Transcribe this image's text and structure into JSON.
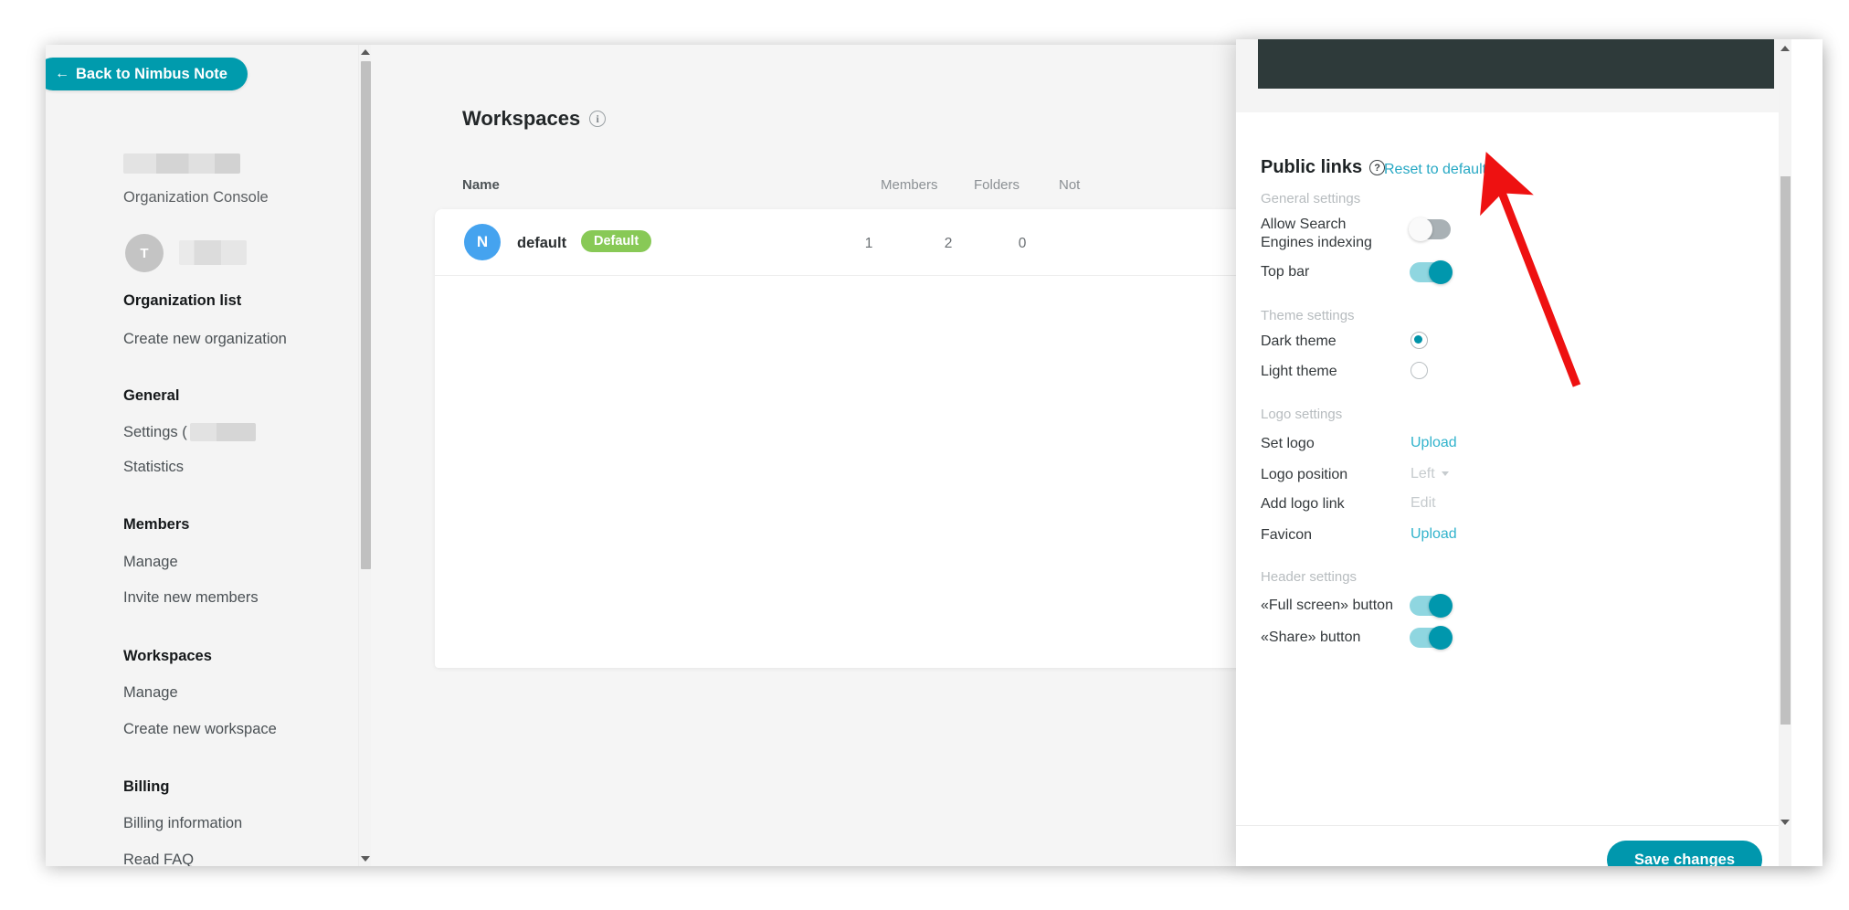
{
  "sidebar": {
    "back_button": {
      "label": "Back to Nimbus Note",
      "icon": "arrow-left-icon"
    },
    "org_console_label": "Organization Console",
    "user_avatar_initial": "T",
    "groups": [
      {
        "title": "Organization list",
        "items": [
          {
            "label": "Create new organization"
          }
        ]
      },
      {
        "title": "General",
        "items": [
          {
            "label": "Settings (",
            "masked": true
          },
          {
            "label": "Statistics"
          }
        ]
      },
      {
        "title": "Members",
        "items": [
          {
            "label": "Manage"
          },
          {
            "label": "Invite new members"
          }
        ]
      },
      {
        "title": "Workspaces",
        "items": [
          {
            "label": "Manage"
          },
          {
            "label": "Create new workspace"
          }
        ]
      },
      {
        "title": "Billing",
        "items": [
          {
            "label": "Billing information"
          },
          {
            "label": "Read FAQ"
          }
        ]
      }
    ]
  },
  "main": {
    "page_title": "Workspaces",
    "page_title_info_icon": "info-icon",
    "table": {
      "columns": [
        "Name",
        "Members",
        "Folders",
        "Not"
      ],
      "rows": [
        {
          "avatar_initial": "N",
          "name": "default",
          "tag": "Default",
          "members": "1",
          "folders": "2",
          "notes": "0"
        }
      ]
    }
  },
  "panel": {
    "title": "Public links",
    "title_help_icon": "question-circle-icon",
    "reset_link": "Reset to default",
    "sections": [
      {
        "label": "General settings",
        "rows": [
          {
            "label": "Allow Search Engines indexing",
            "control": "toggle",
            "value": "off"
          },
          {
            "label": "Top bar",
            "control": "toggle",
            "value": "on"
          }
        ]
      },
      {
        "label": "Theme settings",
        "rows": [
          {
            "label": "Dark theme",
            "control": "radio",
            "value": "checked"
          },
          {
            "label": "Light theme",
            "control": "radio",
            "value": "unchecked"
          }
        ]
      },
      {
        "label": "Logo settings",
        "rows": [
          {
            "label": "Set logo",
            "control": "link",
            "value": "Upload",
            "disabled": false
          },
          {
            "label": "Logo position",
            "control": "select",
            "value": "Left",
            "disabled": true
          },
          {
            "label": "Add logo link",
            "control": "link",
            "value": "Edit",
            "disabled": true
          },
          {
            "label": "Favicon",
            "control": "link",
            "value": "Upload",
            "disabled": false
          }
        ]
      },
      {
        "label": "Header settings",
        "rows": [
          {
            "label": "«Full screen» button",
            "control": "toggle",
            "value": "on"
          },
          {
            "label": "«Share» button",
            "control": "toggle",
            "value": "on"
          }
        ]
      }
    ],
    "save_button": "Save changes"
  },
  "colors": {
    "accent_teal": "#0097ad",
    "link_blue": "#31b3cc",
    "tag_green": "#88c956",
    "avatar_blue": "#45a3ef",
    "preview_dark": "#2e3a3a",
    "annotation_red": "#ee1111"
  }
}
